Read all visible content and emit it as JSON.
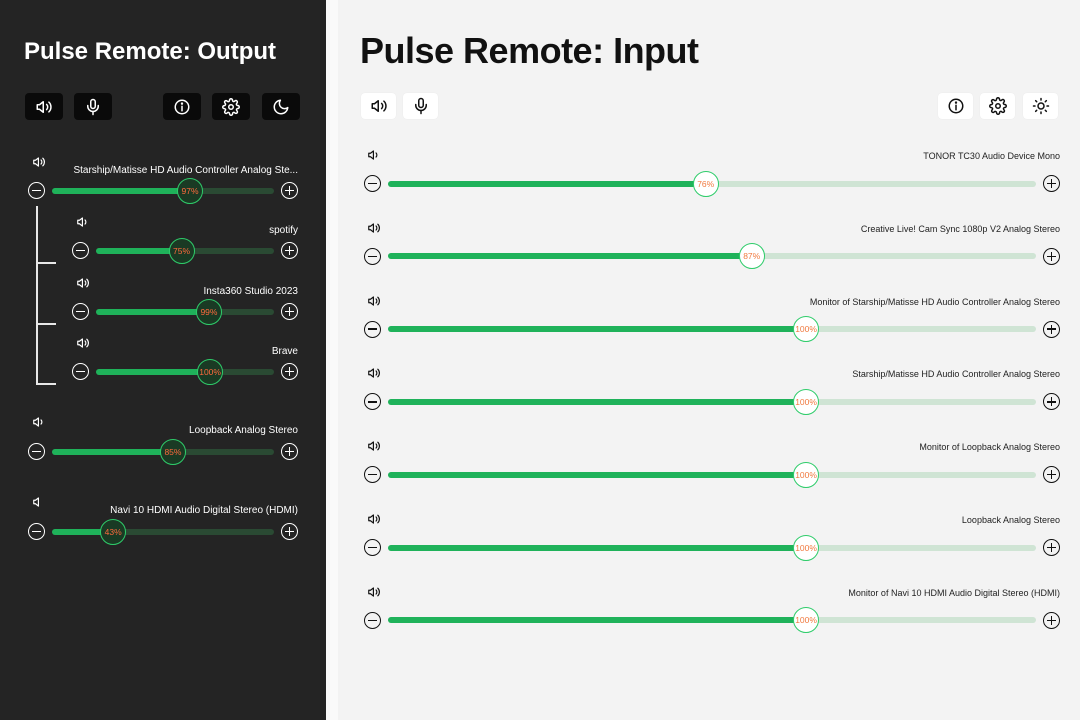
{
  "output": {
    "title": "Pulse Remote: Output",
    "toolbar": {
      "speaker_icon": "speaker-icon",
      "mic_icon": "microphone-icon",
      "info_icon": "info-icon",
      "settings_icon": "gear-icon",
      "theme_icon": "moon-icon"
    },
    "sliders": [
      {
        "label": "Starship/Matisse HD Audio Controller Analog Ste...",
        "value": 97,
        "value_text": "97%",
        "icon": "speaker-high-icon"
      },
      {
        "label": "spotify",
        "value": 75,
        "value_text": "75%",
        "icon": "speaker-low-icon"
      },
      {
        "label": "Insta360 Studio 2023",
        "value": 99,
        "value_text": "99%",
        "icon": "speaker-high-icon"
      },
      {
        "label": "Brave",
        "value": 100,
        "value_text": "100%",
        "icon": "speaker-high-icon"
      },
      {
        "label": "Loopback Analog Stereo",
        "value": 85,
        "value_text": "85%",
        "icon": "speaker-low-icon"
      },
      {
        "label": "Navi 10 HDMI Audio Digital Stereo (HDMI)",
        "value": 43,
        "value_text": "43%",
        "icon": "speaker-mute-icon"
      }
    ]
  },
  "input": {
    "title": "Pulse Remote: Input",
    "toolbar": {
      "speaker_icon": "speaker-icon",
      "mic_icon": "microphone-icon",
      "info_icon": "info-icon",
      "settings_icon": "gear-icon",
      "theme_icon": "sun-icon"
    },
    "sliders": [
      {
        "label": "TONOR TC30 Audio Device Mono",
        "value": 76,
        "value_text": "76%",
        "icon": "speaker-low-icon"
      },
      {
        "label": "Creative Live! Cam Sync 1080p V2 Analog Stereo",
        "value": 87,
        "value_text": "87%",
        "icon": "speaker-high-icon"
      },
      {
        "label": "Monitor of Starship/Matisse HD Audio Controller Analog Stereo",
        "value": 100,
        "value_text": "100%",
        "icon": "speaker-high-icon"
      },
      {
        "label": "Starship/Matisse HD Audio Controller Analog Stereo",
        "value": 100,
        "value_text": "100%",
        "icon": "speaker-high-icon"
      },
      {
        "label": "Monitor of Loopback Analog Stereo",
        "value": 100,
        "value_text": "100%",
        "icon": "speaker-high-icon"
      },
      {
        "label": "Loopback Analog Stereo",
        "value": 100,
        "value_text": "100%",
        "icon": "speaker-high-icon"
      },
      {
        "label": "Monitor of Navi 10 HDMI Audio Digital Stereo (HDMI)",
        "value": 100,
        "value_text": "100%",
        "icon": "speaker-high-icon"
      }
    ]
  },
  "colors": {
    "left_bg": "#242424",
    "right_bg": "#f3f3f3",
    "accent_green": "#1fb25a",
    "knob_border": "#2ecc6a",
    "percent_text": "#ff6a3d"
  }
}
